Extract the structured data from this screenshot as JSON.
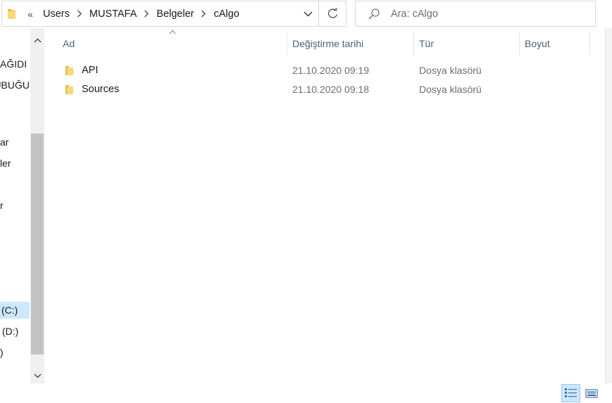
{
  "address_bar": {
    "overflow_marker": "«",
    "breadcrumbs": [
      "Users",
      "MUSTAFA",
      "Belgeler",
      "cAlgo"
    ]
  },
  "search": {
    "placeholder": "Ara: cAlgo",
    "value": ""
  },
  "nav_pane": {
    "items": [
      "AĞIDI",
      "UBUĞU",
      "ar",
      "ler",
      "r",
      "(C:)",
      "(D:)",
      ")"
    ],
    "selected_index": 5
  },
  "columns": {
    "name": "Ad",
    "modified": "Değiştirme tarihi",
    "type": "Tür",
    "size": "Boyut"
  },
  "files": [
    {
      "name": "API",
      "modified": "21.10.2020 09:19",
      "type": "Dosya klasörü",
      "size": ""
    },
    {
      "name": "Sources",
      "modified": "21.10.2020 09:18",
      "type": "Dosya klasörü",
      "size": ""
    }
  ],
  "colors": {
    "folder_yellow": "#f8d775",
    "folder_dark": "#e6b948",
    "selection_bg": "#cce8ff",
    "header_text": "#4c607a"
  }
}
